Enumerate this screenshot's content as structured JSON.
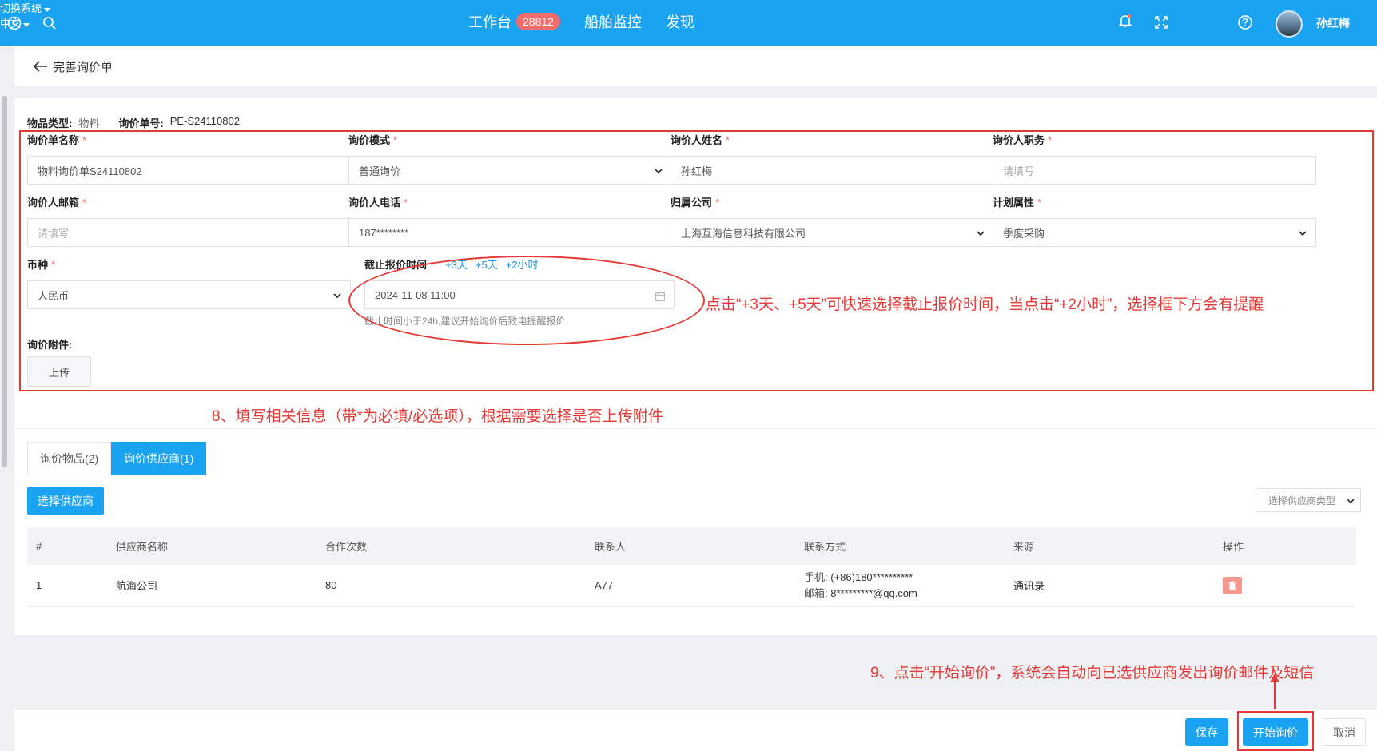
{
  "topbar": {
    "nav": [
      {
        "label": "工作台",
        "badge": "28812"
      },
      {
        "label": "船舶监控"
      },
      {
        "label": "发现"
      }
    ],
    "switch_system": "切换系统",
    "language": "中文",
    "username": "孙红梅"
  },
  "page": {
    "title": "完善询价单"
  },
  "meta": {
    "item_type_label": "物品类型:",
    "item_type_value": "物料",
    "order_no_label": "询价单号:",
    "order_no_value": "PE-S24110802"
  },
  "form": {
    "name": {
      "label": "询价单名称",
      "value": "物料询价单S24110802"
    },
    "mode": {
      "label": "询价模式",
      "value": "普通询价"
    },
    "inquirer_name": {
      "label": "询价人姓名",
      "value": "孙红梅"
    },
    "inquirer_title": {
      "label": "询价人职务",
      "placeholder": "请填写"
    },
    "email": {
      "label": "询价人邮箱",
      "placeholder": "请填写"
    },
    "phone": {
      "label": "询价人电话",
      "value": "187********"
    },
    "company": {
      "label": "归属公司",
      "value": "上海互海信息科技有限公司"
    },
    "plan": {
      "label": "计划属性",
      "value": "季度采购"
    },
    "currency": {
      "label": "币种",
      "value": "人民币"
    },
    "deadline": {
      "label": "截止报价时间",
      "quick": [
        "+3天",
        "+5天",
        "+2小时"
      ],
      "value": "2024-11-08 11:00",
      "hint": "截止时间小于24h,建议开始询价后致电提醒报价"
    },
    "attachment": {
      "label": "询价附件:",
      "upload_label": "上传"
    }
  },
  "annotations": {
    "deadline_note": "点击“+3天、+5天”可快速选择截止报价时间，当点击“+2小时”，选择框下方会有提醒",
    "step8": "8、填写相关信息（带*为必填/必选项），根据需要选择是否上传附件",
    "step9": "9、点击“开始询价”，系统会自动向已选供应商发出询价邮件及短信"
  },
  "suppliers": {
    "tabs": [
      "询价物品(2)",
      "询价供应商(1)"
    ],
    "select_button": "选择供应商",
    "type_select_placeholder": "选择供应商类型",
    "columns": [
      "#",
      "供应商名称",
      "合作次数",
      "联系人",
      "联系方式",
      "来源",
      "操作"
    ],
    "rows": [
      {
        "index": "1",
        "name": "航海公司",
        "cooperation_count": "80",
        "contact": "A77",
        "mobile_label": "手机:",
        "mobile": "(+86)180**********",
        "email_label": "邮箱:",
        "email": "8*********@qq.com",
        "source": "通讯录"
      }
    ]
  },
  "footer": {
    "save": "保存",
    "start": "开始询价",
    "cancel": "取消"
  },
  "colors": {
    "primary": "#1aa3f0",
    "annotation_red": "#e53935",
    "badge": "#f56c6c",
    "delete": "#f5988f"
  }
}
